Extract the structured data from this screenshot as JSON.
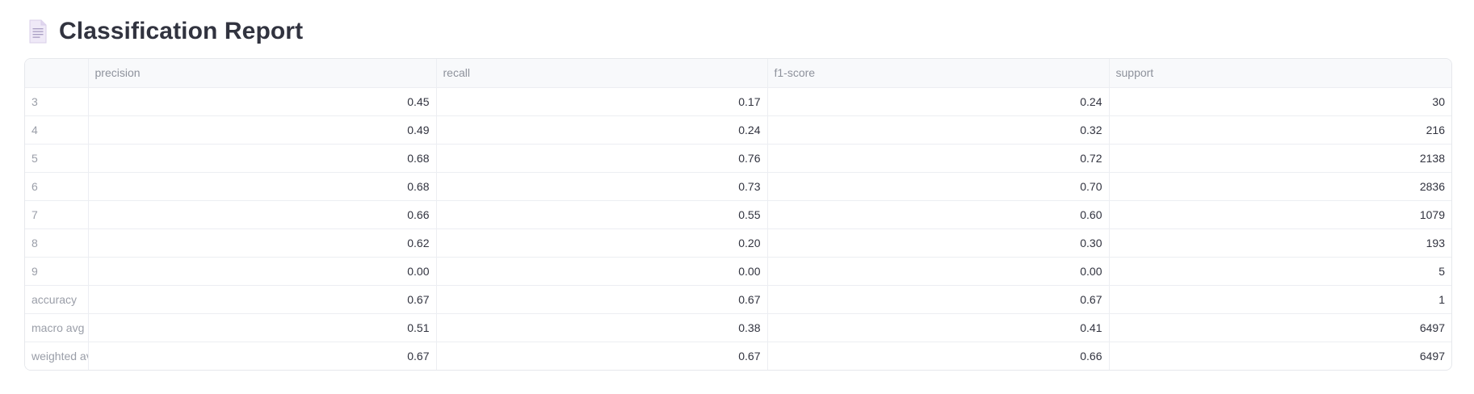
{
  "header": {
    "icon": "page-facing-up-icon",
    "title": "Classification Report"
  },
  "table": {
    "columns": [
      "precision",
      "recall",
      "f1-score",
      "support"
    ],
    "rows": [
      {
        "label": "3",
        "precision": "0.45",
        "recall": "0.17",
        "f1": "0.24",
        "support": "30"
      },
      {
        "label": "4",
        "precision": "0.49",
        "recall": "0.24",
        "f1": "0.32",
        "support": "216"
      },
      {
        "label": "5",
        "precision": "0.68",
        "recall": "0.76",
        "f1": "0.72",
        "support": "2138"
      },
      {
        "label": "6",
        "precision": "0.68",
        "recall": "0.73",
        "f1": "0.70",
        "support": "2836"
      },
      {
        "label": "7",
        "precision": "0.66",
        "recall": "0.55",
        "f1": "0.60",
        "support": "1079"
      },
      {
        "label": "8",
        "precision": "0.62",
        "recall": "0.20",
        "f1": "0.30",
        "support": "193"
      },
      {
        "label": "9",
        "precision": "0.00",
        "recall": "0.00",
        "f1": "0.00",
        "support": "5"
      },
      {
        "label": "accuracy",
        "precision": "0.67",
        "recall": "0.67",
        "f1": "0.67",
        "support": "1"
      },
      {
        "label": "macro avg",
        "precision": "0.51",
        "recall": "0.38",
        "f1": "0.41",
        "support": "6497"
      },
      {
        "label": "weighted avg",
        "precision": "0.67",
        "recall": "0.67",
        "f1": "0.66",
        "support": "6497"
      }
    ]
  }
}
